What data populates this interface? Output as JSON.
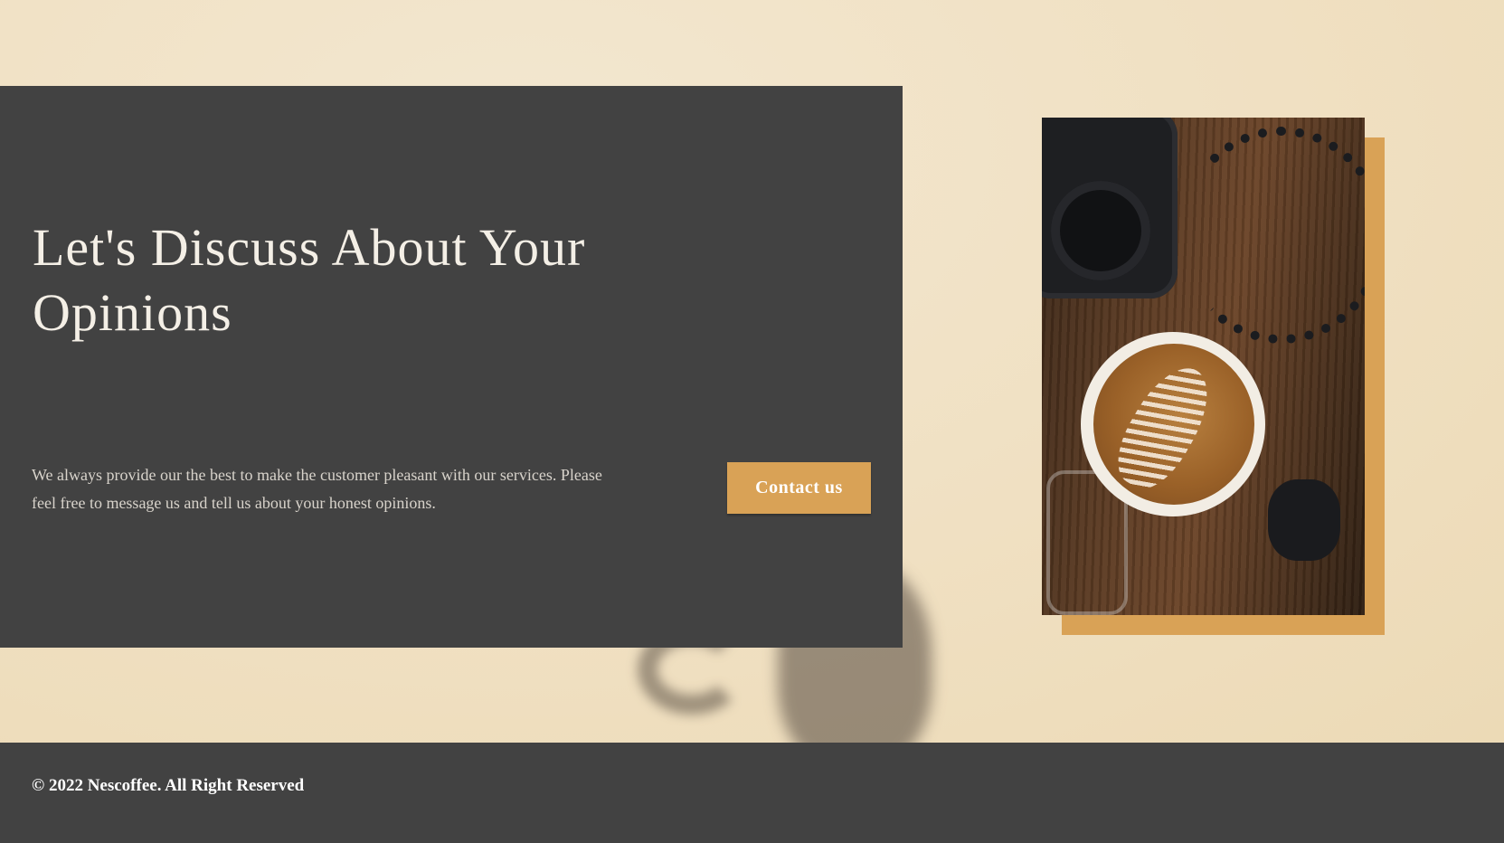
{
  "hero": {
    "headline": "Let's Discuss About Your Opinions",
    "description": "We always provide our the best to make the customer pleasant with our services. Please feel free to message us and tell us about your honest opinions.",
    "cta_label": "Contact us"
  },
  "footer": {
    "copyright": "© 2022 Nescoffee. All Right Reserved"
  },
  "colors": {
    "background": "#f1e3c6",
    "panel": "#424242",
    "accent": "#d9a256",
    "footer": "#424242"
  },
  "images": {
    "hero_photo": "coffee-latte-and-rotary-phone-photo"
  }
}
